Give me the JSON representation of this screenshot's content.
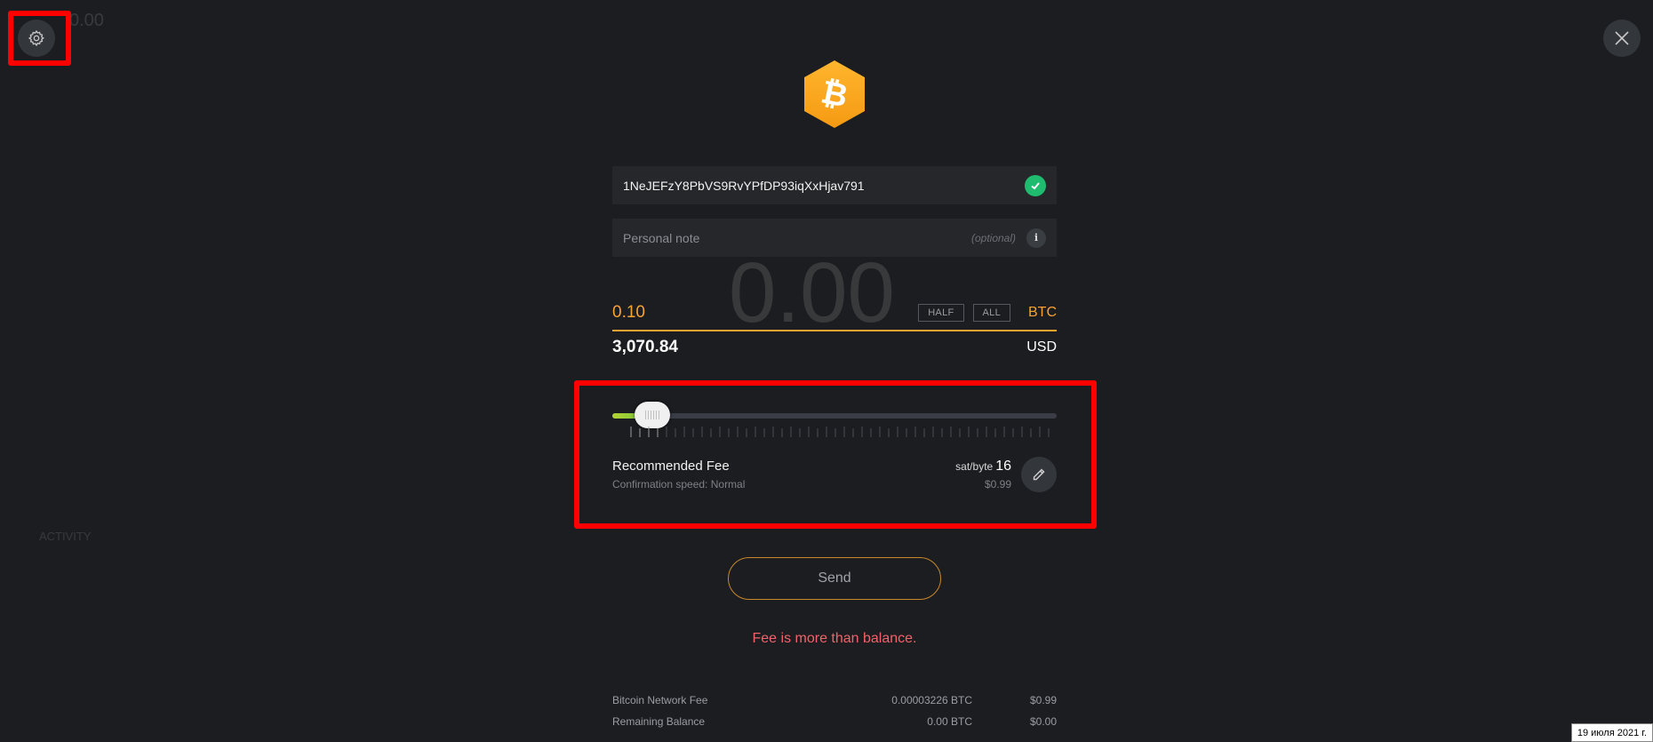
{
  "background": {
    "balance": "0.00",
    "big_amount": "0.00",
    "activity": "ACTIVITY"
  },
  "header": {
    "settings_icon": "gear-icon",
    "close_icon": "close-icon"
  },
  "coin": {
    "icon": "bitcoin-icon",
    "color": "#f7a334"
  },
  "address": {
    "value": "1NeJEFzY8PbVS9RvYPfDP93iqXxHjav791",
    "status_icon": "check-icon"
  },
  "note": {
    "placeholder": "Personal note",
    "optional": "(optional)",
    "info": "i"
  },
  "amount": {
    "value": "0.10",
    "half_label": "HALF",
    "all_label": "ALL",
    "unit": "BTC",
    "usd_value": "3,070.84",
    "usd_unit": "USD"
  },
  "fee": {
    "slider_level_percent": 9,
    "title": "Recommended Fee",
    "subtitle": "Confirmation speed: Normal",
    "rate_label": "sat/byte",
    "rate_value": "16",
    "usd": "$0.99",
    "edit_icon": "pencil-icon"
  },
  "send": {
    "label": "Send"
  },
  "error": "Fee is more than balance.",
  "summary": [
    {
      "label": "Bitcoin Network Fee",
      "btc": "0.00003226 BTC",
      "usd": "$0.99"
    },
    {
      "label": "Remaining Balance",
      "btc": "0.00 BTC",
      "usd": "$0.00"
    }
  ],
  "date": "19 июля 2021 г.",
  "colors": {
    "accent": "#f7a334",
    "error": "#f2626a",
    "success": "#1fbb6e",
    "highlight": "#ff0000"
  }
}
